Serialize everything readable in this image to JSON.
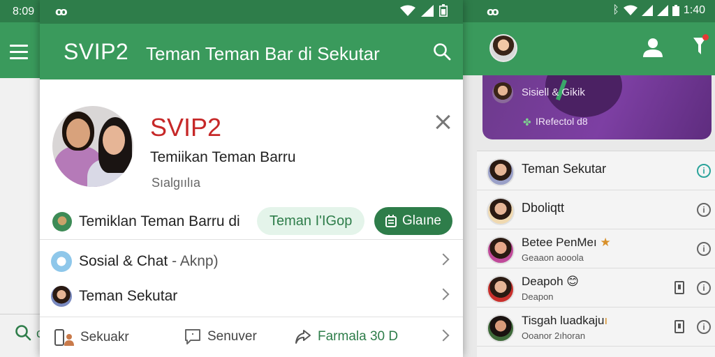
{
  "left_screen": {
    "status_time": "8:09",
    "menu_icon": "hamburger-icon",
    "search_icon": "search-icon"
  },
  "main": {
    "status_bar": {
      "notification_icon": "android-notification-icon",
      "icons": [
        "wifi-icon",
        "signal-icon",
        "battery-icon"
      ]
    },
    "app_bar": {
      "brand": "SVIP2",
      "title": "Teman Teman Bar di Sekutar",
      "search_icon": "search-icon"
    },
    "profile": {
      "title": "SVIP2",
      "subtitle": "Temiikan Teman Barru",
      "meta": "Sıalgıılıa",
      "close_icon": "close-icon"
    },
    "suggestion_row": {
      "text": "Temiklan Teman Barru di",
      "chip_label": "Teman I'IGop",
      "button_label": "Glaıne",
      "button_icon": "calendar-icon"
    },
    "list": [
      {
        "label": "Sosial & Chat",
        "suffix": "- Aknp)",
        "icon": "social-chat-icon"
      },
      {
        "label": "Teman Sekutar",
        "icon": "avatar"
      }
    ],
    "bottom_tabs": [
      {
        "label": "Sekuakr",
        "icon": "people-icon"
      },
      {
        "label": "Senuver",
        "icon": "chat-icon"
      },
      {
        "label": "Farmala 30 D",
        "icon": "share-icon"
      }
    ]
  },
  "right_screen": {
    "status_bar": {
      "time": "1:40",
      "notification_icon": "android-notification-icon",
      "icons": [
        "bluetooth-icon",
        "wifi-icon",
        "signal-icon",
        "signal-icon",
        "battery-icon"
      ]
    },
    "app_bar": {
      "icons": [
        "avatar",
        "person-icon",
        "filter-icon"
      ]
    },
    "promo": {
      "title": "Sisiell & Gikik",
      "subtitle": "IRefectol d8"
    },
    "list": [
      {
        "name": "Teman Sekutar",
        "sub": "",
        "emoji": ""
      },
      {
        "name": "Dboliqtt",
        "sub": "",
        "emoji": ""
      },
      {
        "name": "Betee PenMeı",
        "sub": "Geaaon aooola",
        "emoji": "★"
      },
      {
        "name": "Deapoh",
        "sub": "Deapon",
        "emoji": "😊"
      },
      {
        "name": "Tisgah luadkaju",
        "sub": "Ooanor 2ıhoran",
        "emoji": "ı"
      }
    ]
  },
  "colors": {
    "status_green": "#2e7d4a",
    "appbar_green": "#3a9a5c",
    "brand_red": "#c62828",
    "chip_bg": "#e4f4ea",
    "promo_purple": "#7d3fa3"
  }
}
